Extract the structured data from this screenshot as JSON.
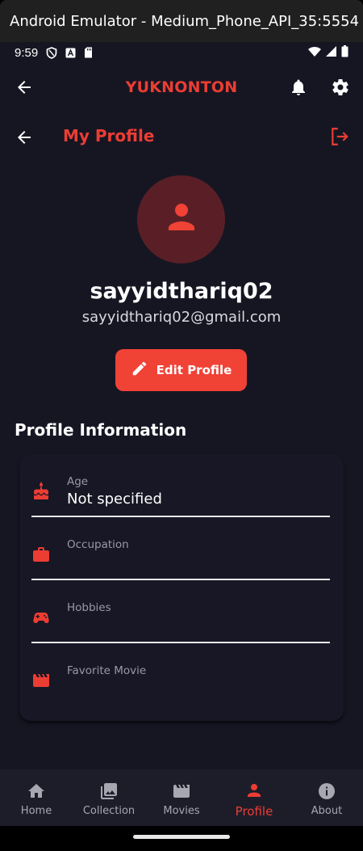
{
  "window": {
    "title": "Android Emulator - Medium_Phone_API_35:5554"
  },
  "status_bar": {
    "time": "9:59"
  },
  "app_bar": {
    "title": "YUKNONTON"
  },
  "profile_header": {
    "title": "My Profile"
  },
  "profile": {
    "username": "sayyidthariq02",
    "email": "sayyidthariq02@gmail.com",
    "edit_label": "Edit Profile"
  },
  "info_section": {
    "title": "Profile Information",
    "fields": [
      {
        "label": "Age",
        "value": "Not specified",
        "icon": "cake-icon"
      },
      {
        "label": "Occupation",
        "value": "",
        "icon": "briefcase-icon"
      },
      {
        "label": "Hobbies",
        "value": "",
        "icon": "gamepad-icon"
      },
      {
        "label": "Favorite Movie",
        "value": "",
        "icon": "movie-clapper-icon"
      }
    ]
  },
  "bottom_nav": {
    "items": [
      {
        "label": "Home",
        "icon": "home-icon"
      },
      {
        "label": "Collection",
        "icon": "photo-library-icon"
      },
      {
        "label": "Movies",
        "icon": "movie-clapper-icon"
      },
      {
        "label": "Profile",
        "icon": "person-icon",
        "active": true
      },
      {
        "label": "About",
        "icon": "info-icon"
      }
    ]
  },
  "colors": {
    "accent": "#ec3d33",
    "background": "#161623",
    "nav_background": "#1d1d2a",
    "avatar_background": "#5a1f26"
  }
}
